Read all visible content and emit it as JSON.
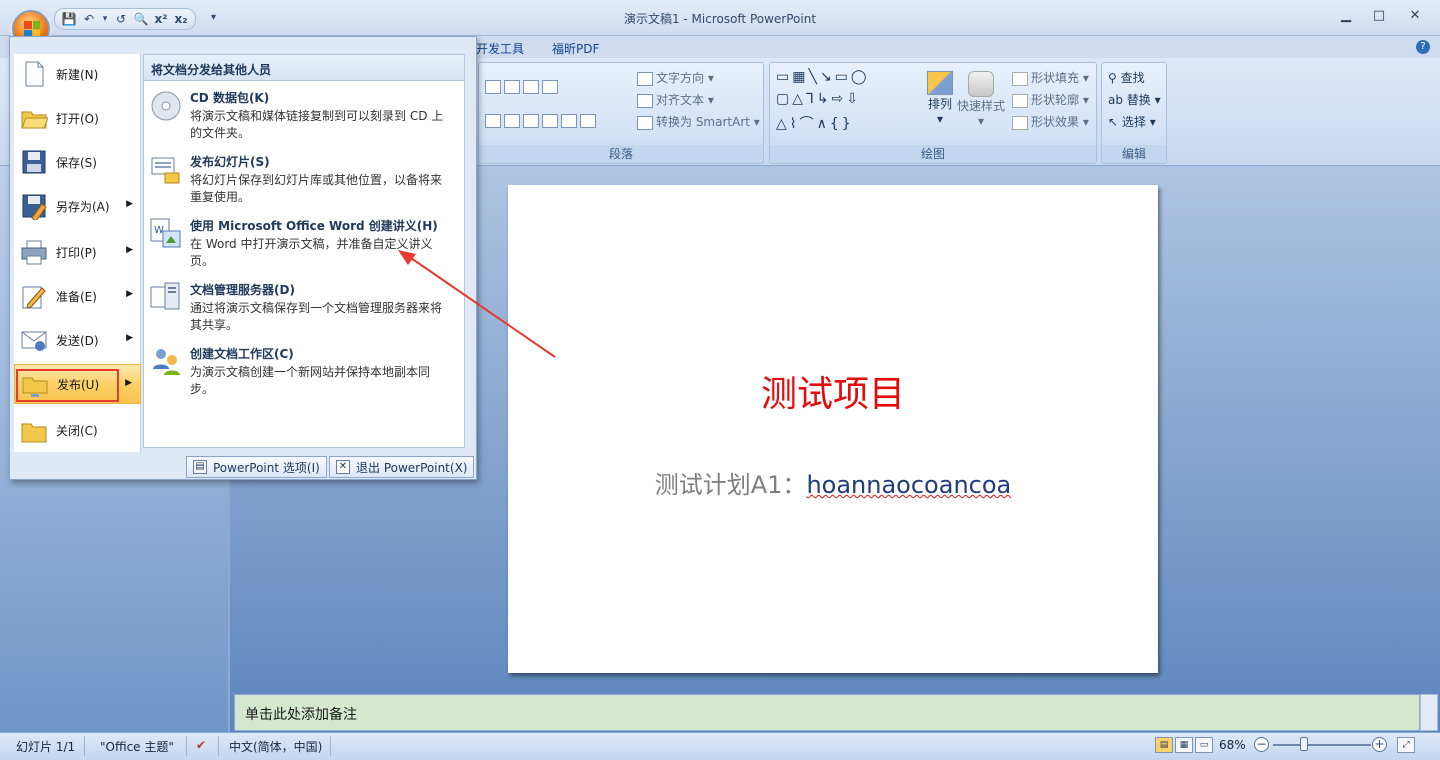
{
  "window": {
    "title": "演示文稿1 - Microsoft PowerPoint",
    "minimize": "▁",
    "maximize": "□",
    "close": "✕"
  },
  "qat": {
    "items": [
      "💾",
      "↶",
      "▾",
      "↺",
      "🔍",
      "x²",
      "x₂"
    ],
    "more": "▾"
  },
  "tabs": [
    "开发工具",
    "福昕PDF"
  ],
  "help": "?",
  "ribbon": {
    "paragraph": {
      "label": "段落",
      "text_direction": "文字方向",
      "align_text": "对齐文本",
      "smartart": "转换为 SmartArt"
    },
    "drawing": {
      "label": "绘图",
      "arrange": "排列",
      "quick_styles": "快速样式",
      "shape_fill": "形状填充",
      "shape_outline": "形状轮廓",
      "shape_effects": "形状效果"
    },
    "editing": {
      "label": "编辑",
      "find": "查找",
      "replace": "替换",
      "select": "选择"
    }
  },
  "slide": {
    "title": "测试项目",
    "subtitle_prefix": "测试计划A1：",
    "subtitle_link": "hoannaocoancoa"
  },
  "notes": {
    "placeholder": "单击此处添加备注"
  },
  "status": {
    "slide": "幻灯片 1/1",
    "theme": "\"Office 主题\"",
    "language": "中文(简体，中国)",
    "zoom": "68%",
    "zoom_value": 68
  },
  "office_menu": {
    "items": [
      {
        "label": "新建(N)",
        "arrow": false
      },
      {
        "label": "打开(O)",
        "arrow": false
      },
      {
        "label": "保存(S)",
        "arrow": false
      },
      {
        "label": "另存为(A)",
        "arrow": true
      },
      {
        "label": "打印(P)",
        "arrow": true
      },
      {
        "label": "准备(E)",
        "arrow": true
      },
      {
        "label": "发送(D)",
        "arrow": true
      },
      {
        "label": "发布(U)",
        "arrow": true
      },
      {
        "label": "关闭(C)",
        "arrow": false
      }
    ],
    "submenu": {
      "header": "将文档分发给其他人员",
      "items": [
        {
          "title": "CD 数据包(K)",
          "desc": "将演示文稿和媒体链接复制到可以刻录到 CD 上的文件夹。"
        },
        {
          "title": "发布幻灯片(S)",
          "desc": "将幻灯片保存到幻灯片库或其他位置，以备将来重复使用。"
        },
        {
          "title": "使用 Microsoft Office Word 创建讲义(H)",
          "desc": "在 Word 中打开演示文稿，并准备自定义讲义页。"
        },
        {
          "title": "文档管理服务器(D)",
          "desc": "通过将演示文稿保存到一个文档管理服务器来将其共享。"
        },
        {
          "title": "创建文档工作区(C)",
          "desc": "为演示文稿创建一个新网站并保持本地副本同步。"
        }
      ]
    },
    "options_button": "PowerPoint 选项(I)",
    "exit_button": "退出 PowerPoint(X)"
  }
}
